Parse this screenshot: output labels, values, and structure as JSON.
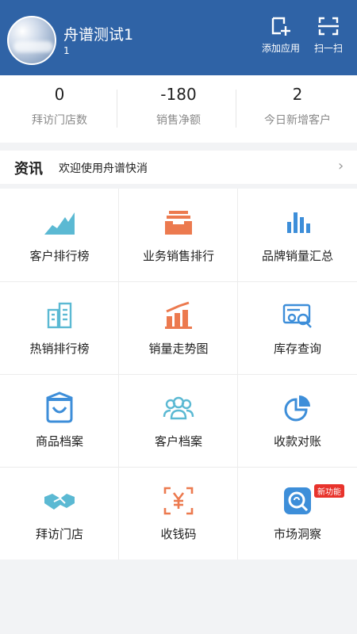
{
  "header": {
    "user_name": "舟谱测试1",
    "user_sub": "1",
    "add_app_label": "添加应用",
    "scan_label": "扫一扫"
  },
  "stats": [
    {
      "value": "0",
      "caption": "拜访门店数"
    },
    {
      "value": "-180",
      "caption": "销售净额"
    },
    {
      "value": "2",
      "caption": "今日新增客户"
    }
  ],
  "news": {
    "tag": "资讯",
    "message": "欢迎使用舟谱快消",
    "chevron": "›"
  },
  "grid": [
    {
      "label": "客户排行榜",
      "icon": "area-chart-icon",
      "color": "#5bb9d3"
    },
    {
      "label": "业务销售排行",
      "icon": "tray-icon",
      "color": "#ec7a4f"
    },
    {
      "label": "品牌销量汇总",
      "icon": "bar-chart-icon",
      "color": "#3d8ed9"
    },
    {
      "label": "热销排行榜",
      "icon": "columns-icon",
      "color": "#5bb9d3"
    },
    {
      "label": "销量走势图",
      "icon": "trend-chart-icon",
      "color": "#ec7a4f"
    },
    {
      "label": "库存查询",
      "icon": "stock-search-icon",
      "color": "#3d8ed9"
    },
    {
      "label": "商品档案",
      "icon": "shopping-bag-icon",
      "color": "#3d8ed9"
    },
    {
      "label": "客户档案",
      "icon": "people-icon",
      "color": "#5bb9d3"
    },
    {
      "label": "收款对账",
      "icon": "pie-chart-icon",
      "color": "#3d8ed9"
    },
    {
      "label": "拜访门店",
      "icon": "handshake-icon",
      "color": "#5bb9d3"
    },
    {
      "label": "收钱码",
      "icon": "yuan-code-icon",
      "color": "#ec7a4f"
    },
    {
      "label": "市场洞察",
      "icon": "market-insight-icon",
      "color": "#3d8ed9"
    }
  ],
  "new_feature_badge": "新功能",
  "colors": {
    "header_bg": "#2f63a6",
    "page_bg": "#f2f3f5"
  }
}
